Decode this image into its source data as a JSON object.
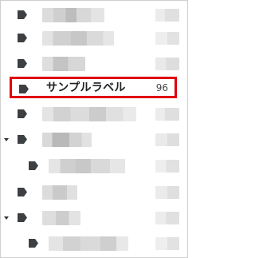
{
  "labels_panel": {
    "selected_label": {
      "name": "サンプルラベル",
      "count": "96",
      "icon": "label-tag-icon"
    },
    "colors": {
      "highlight_border": "#e0000b",
      "tag_icon": "#3c4043",
      "redacted": "#d9d9d9"
    }
  }
}
